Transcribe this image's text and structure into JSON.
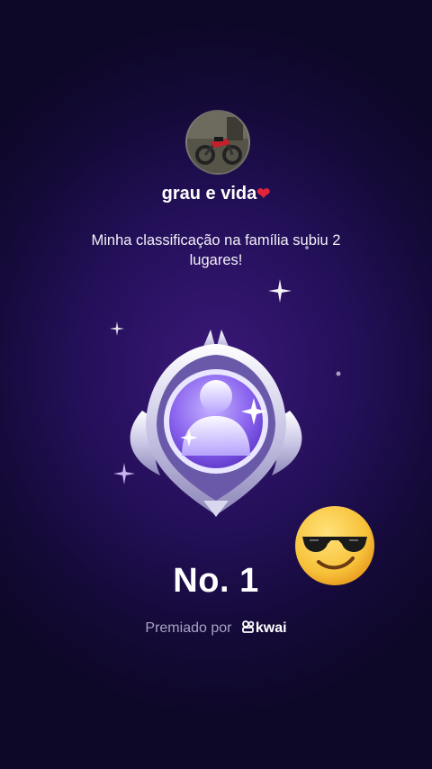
{
  "profile": {
    "username": "grau e vida",
    "heart": "❤"
  },
  "message": "Minha classificação na família subiu 2 lugares!",
  "rank_label": "No. 1",
  "awarded": {
    "prefix": "Premiado por",
    "brand": "kwai"
  },
  "icons": [
    "avatar-photo",
    "ranking-badge-icon",
    "sunglasses-emoji",
    "kwai-logo-icon",
    "sparkle-icon"
  ],
  "colors": {
    "background": "#1f0e4c",
    "heart": "#e0243a",
    "badge_purple": "#8f6cf0",
    "emoji_yellow": "#f7c23a"
  }
}
